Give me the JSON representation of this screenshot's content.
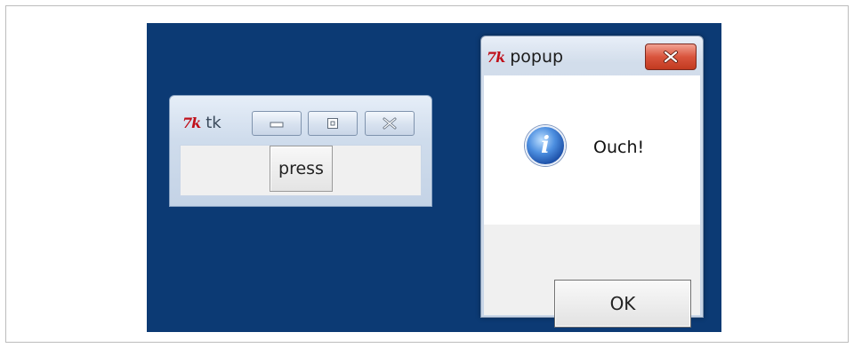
{
  "tk_window": {
    "icon": "tk-logo-icon",
    "logo_text": "7k",
    "title": "tk",
    "button_label": "press",
    "controls": [
      "minimize-icon",
      "maximize-icon",
      "close-icon"
    ]
  },
  "popup": {
    "icon": "tk-logo-icon",
    "logo_text": "7k",
    "title": "popup",
    "message_icon": "info-icon",
    "info_glyph": "i",
    "message": "Ouch!",
    "ok_label": "OK"
  },
  "colors": {
    "desktop": "#0c3a74",
    "close_button": "#d9553d"
  }
}
